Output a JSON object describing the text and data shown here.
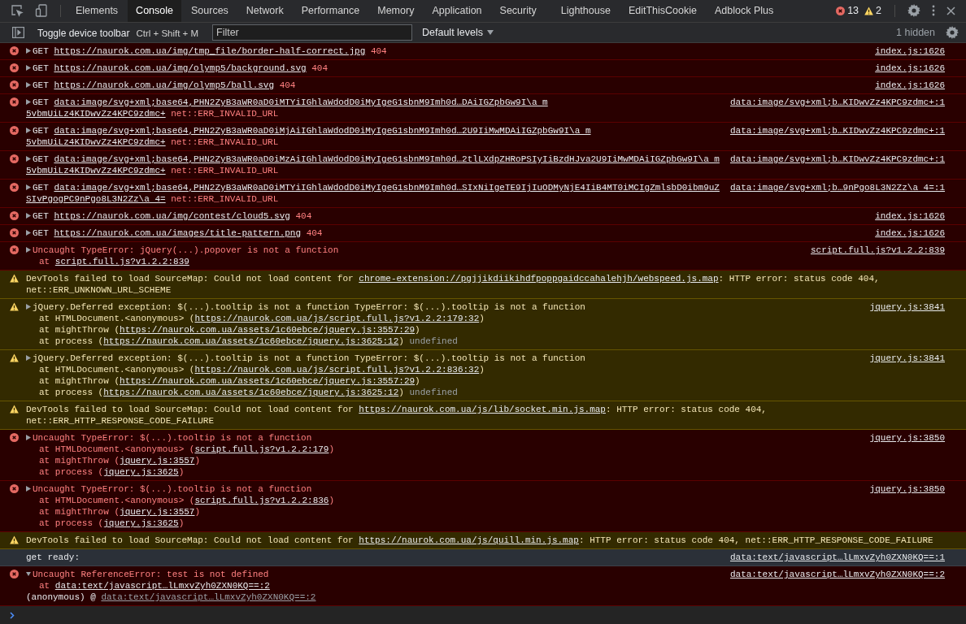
{
  "toolbar": {
    "tabs": [
      {
        "label": "Elements",
        "selected": false
      },
      {
        "label": "Console",
        "selected": true
      },
      {
        "label": "Sources",
        "selected": false
      },
      {
        "label": "Network",
        "selected": false
      },
      {
        "label": "Performance",
        "selected": false
      },
      {
        "label": "Memory",
        "selected": false
      },
      {
        "label": "Application",
        "selected": false
      },
      {
        "label": "Security",
        "selected": false
      },
      {
        "label": "Lighthouse",
        "selected": false
      },
      {
        "label": "EditThisCookie",
        "selected": false
      },
      {
        "label": "Adblock Plus",
        "selected": false
      }
    ],
    "error_count": "13",
    "warning_count": "2"
  },
  "filter_bar": {
    "tooltip": {
      "label": "Toggle device toolbar",
      "shortcut": "Ctrl + Shift + M"
    },
    "filter": {
      "placeholder": "Filter"
    },
    "levels": "Default levels",
    "hidden": "1 hidden"
  },
  "messages": [
    {
      "kind": "error",
      "expanded": false,
      "source": "index.js:1626",
      "lines": [
        {
          "kind": "main",
          "parts": [
            {
              "kind": "bright",
              "t": "GET "
            },
            {
              "kind": "link",
              "t": "https://naurok.com.ua/img/tmp_file/border-half-correct.jpg"
            },
            {
              "kind": "text",
              "t": " 404"
            }
          ]
        }
      ]
    },
    {
      "kind": "error",
      "expanded": false,
      "source": "index.js:1626",
      "lines": [
        {
          "kind": "main",
          "parts": [
            {
              "kind": "bright",
              "t": "GET "
            },
            {
              "kind": "link",
              "t": "https://naurok.com.ua/img/olymp5/background.svg"
            },
            {
              "kind": "text",
              "t": " 404"
            }
          ]
        }
      ]
    },
    {
      "kind": "error",
      "expanded": false,
      "source": "index.js:1626",
      "lines": [
        {
          "kind": "main",
          "parts": [
            {
              "kind": "bright",
              "t": "GET "
            },
            {
              "kind": "link",
              "t": "https://naurok.com.ua/img/olymp5/ball.svg"
            },
            {
              "kind": "text",
              "t": " 404"
            }
          ]
        }
      ]
    },
    {
      "kind": "error",
      "expanded": false,
      "source": "data:image/svg+xml;b…KIDwvZz4KPC9zdmc+:1",
      "lines": [
        {
          "kind": "main",
          "parts": [
            {
              "kind": "bright",
              "t": "GET "
            },
            {
              "kind": "link",
              "t": "data:image/svg+xml;base64,PHN2ZyB3aWR0aD0iMTYiIGhlaWdodD0iMyIgeG1sbnM9Imh0d…DAiIGZpbGw9I\\a m"
            }
          ]
        },
        {
          "kind": "wrap",
          "parts": [
            {
              "kind": "link",
              "t": "5vbmUiLz4KIDwvZz4KPC9zdmc+"
            },
            {
              "kind": "text",
              "t": " net::ERR_INVALID_URL"
            }
          ]
        }
      ]
    },
    {
      "kind": "error",
      "expanded": false,
      "source": "data:image/svg+xml;b…KIDwvZz4KPC9zdmc+:1",
      "lines": [
        {
          "kind": "main",
          "parts": [
            {
              "kind": "bright",
              "t": "GET "
            },
            {
              "kind": "link",
              "t": "data:image/svg+xml;base64,PHN2ZyB3aWR0aD0iMjAiIGhlaWdodD0iMyIgeG1sbnM9Imh0d…2U9IiMwMDAiIGZpbGw9I\\a m"
            }
          ]
        },
        {
          "kind": "wrap",
          "parts": [
            {
              "kind": "link",
              "t": "5vbmUiLz4KIDwvZz4KPC9zdmc+"
            },
            {
              "kind": "text",
              "t": " net::ERR_INVALID_URL"
            }
          ]
        }
      ]
    },
    {
      "kind": "error",
      "expanded": false,
      "source": "data:image/svg+xml;b…KIDwvZz4KPC9zdmc+:1",
      "lines": [
        {
          "kind": "main",
          "parts": [
            {
              "kind": "bright",
              "t": "GET "
            },
            {
              "kind": "link",
              "t": "data:image/svg+xml;base64,PHN2ZyB3aWR0aD0iMzAiIGhlaWdodD0iMyIgeG1sbnM9Imh0d…2tlLXdpZHRoPSIyIiBzdHJva2U9IiMwMDAiIGZpbGw9I\\a m"
            }
          ]
        },
        {
          "kind": "wrap",
          "parts": [
            {
              "kind": "link",
              "t": "5vbmUiLz4KIDwvZz4KPC9zdmc+"
            },
            {
              "kind": "text",
              "t": " net::ERR_INVALID_URL"
            }
          ]
        }
      ]
    },
    {
      "kind": "error",
      "expanded": false,
      "source": "data:image/svg+xml;b…9nPgo8L3N2Zz\\a 4=:1",
      "lines": [
        {
          "kind": "main",
          "parts": [
            {
              "kind": "bright",
              "t": "GET "
            },
            {
              "kind": "link",
              "t": "data:image/svg+xml;base64,PHN2ZyB3aWR0aD0iMTYiIGhlaWdodD0iMyIgeG1sbnM9Imh0d…SIxNiIgeTE9IjIuODMyNjE4IiB4MT0iMCIgZmlsbD0ibm9uZ"
            }
          ]
        },
        {
          "kind": "wrap",
          "parts": [
            {
              "kind": "link",
              "t": "SIvPgogPC9nPgo8L3N2Zz\\a 4="
            },
            {
              "kind": "text",
              "t": " net::ERR_INVALID_URL"
            }
          ]
        }
      ]
    },
    {
      "kind": "error",
      "expanded": false,
      "source": "index.js:1626",
      "lines": [
        {
          "kind": "main",
          "parts": [
            {
              "kind": "bright",
              "t": "GET "
            },
            {
              "kind": "link",
              "t": "https://naurok.com.ua/img/contest/cloud5.svg"
            },
            {
              "kind": "text",
              "t": " 404"
            }
          ]
        }
      ]
    },
    {
      "kind": "error",
      "expanded": false,
      "source": "index.js:1626",
      "lines": [
        {
          "kind": "main",
          "parts": [
            {
              "kind": "bright",
              "t": "GET "
            },
            {
              "kind": "link",
              "t": "https://naurok.com.ua/images/title-pattern.png"
            },
            {
              "kind": "text",
              "t": " 404"
            }
          ]
        }
      ]
    },
    {
      "kind": "error",
      "expanded": false,
      "source": "script.full.js?v1.2.2:839",
      "lines": [
        {
          "kind": "main",
          "parts": [
            {
              "kind": "text",
              "t": "Uncaught TypeError: jQuery(...).popover is not a function"
            }
          ]
        },
        {
          "kind": "stack",
          "parts": [
            {
              "kind": "text",
              "t": "at "
            },
            {
              "kind": "link",
              "t": "script.full.js?v1.2.2:839"
            }
          ]
        }
      ]
    },
    {
      "kind": "warning",
      "lines": [
        {
          "kind": "main",
          "parts": [
            {
              "kind": "text",
              "t": "DevTools failed to load SourceMap: Could not load content for "
            },
            {
              "kind": "link",
              "t": "chrome-extension://pgjjikdiikihdfpoppgaidccahalehjh/webspeed.js.map"
            },
            {
              "kind": "text",
              "t": ": HTTP error: status code 404,"
            }
          ]
        },
        {
          "kind": "plainwrap",
          "parts": [
            {
              "kind": "text",
              "t": "net::ERR_UNKNOWN_URL_SCHEME"
            }
          ]
        }
      ]
    },
    {
      "kind": "warning",
      "expanded": false,
      "source": "jquery.js:3841",
      "lines": [
        {
          "kind": "main",
          "parts": [
            {
              "kind": "text",
              "t": "jQuery.Deferred exception: $(...).tooltip is not a function TypeError: $(...).tooltip is not a function"
            }
          ]
        },
        {
          "kind": "stack",
          "parts": [
            {
              "kind": "text",
              "t": "at HTMLDocument.<anonymous> ("
            },
            {
              "kind": "link",
              "t": "https://naurok.com.ua/js/script.full.js?v1.2.2:179:32"
            },
            {
              "kind": "text",
              "t": ")"
            }
          ]
        },
        {
          "kind": "stack",
          "parts": [
            {
              "kind": "text",
              "t": "at mightThrow ("
            },
            {
              "kind": "link",
              "t": "https://naurok.com.ua/assets/1c60ebce/jquery.js:3557:29"
            },
            {
              "kind": "text",
              "t": ")"
            }
          ]
        },
        {
          "kind": "stack",
          "parts": [
            {
              "kind": "text",
              "t": "at process ("
            },
            {
              "kind": "link",
              "t": "https://naurok.com.ua/assets/1c60ebce/jquery.js:3625:12"
            },
            {
              "kind": "text",
              "t": ") "
            },
            {
              "kind": "dim",
              "t": "undefined"
            }
          ]
        }
      ]
    },
    {
      "kind": "warning",
      "expanded": false,
      "source": "jquery.js:3841",
      "lines": [
        {
          "kind": "main",
          "parts": [
            {
              "kind": "text",
              "t": "jQuery.Deferred exception: $(...).tooltip is not a function TypeError: $(...).tooltip is not a function"
            }
          ]
        },
        {
          "kind": "stack",
          "parts": [
            {
              "kind": "text",
              "t": "at HTMLDocument.<anonymous> ("
            },
            {
              "kind": "link",
              "t": "https://naurok.com.ua/js/script.full.js?v1.2.2:836:32"
            },
            {
              "kind": "text",
              "t": ")"
            }
          ]
        },
        {
          "kind": "stack",
          "parts": [
            {
              "kind": "text",
              "t": "at mightThrow ("
            },
            {
              "kind": "link",
              "t": "https://naurok.com.ua/assets/1c60ebce/jquery.js:3557:29"
            },
            {
              "kind": "text",
              "t": ")"
            }
          ]
        },
        {
          "kind": "stack",
          "parts": [
            {
              "kind": "text",
              "t": "at process ("
            },
            {
              "kind": "link",
              "t": "https://naurok.com.ua/assets/1c60ebce/jquery.js:3625:12"
            },
            {
              "kind": "text",
              "t": ") "
            },
            {
              "kind": "dim",
              "t": "undefined"
            }
          ]
        }
      ]
    },
    {
      "kind": "warning",
      "lines": [
        {
          "kind": "main",
          "parts": [
            {
              "kind": "text",
              "t": "DevTools failed to load SourceMap: Could not load content for "
            },
            {
              "kind": "link",
              "t": "https://naurok.com.ua/js/lib/socket.min.js.map"
            },
            {
              "kind": "text",
              "t": ": HTTP error: status code 404,"
            }
          ]
        },
        {
          "kind": "plainwrap",
          "parts": [
            {
              "kind": "text",
              "t": "net::ERR_HTTP_RESPONSE_CODE_FAILURE"
            }
          ]
        }
      ]
    },
    {
      "kind": "error",
      "expanded": false,
      "source": "jquery.js:3850",
      "lines": [
        {
          "kind": "main",
          "parts": [
            {
              "kind": "text",
              "t": "Uncaught TypeError: $(...).tooltip is not a function"
            }
          ]
        },
        {
          "kind": "stack",
          "parts": [
            {
              "kind": "text",
              "t": "at HTMLDocument.<anonymous> ("
            },
            {
              "kind": "link",
              "t": "script.full.js?v1.2.2:179"
            },
            {
              "kind": "text",
              "t": ")"
            }
          ]
        },
        {
          "kind": "stack",
          "parts": [
            {
              "kind": "text",
              "t": "at mightThrow ("
            },
            {
              "kind": "link",
              "t": "jquery.js:3557"
            },
            {
              "kind": "text",
              "t": ")"
            }
          ]
        },
        {
          "kind": "stack",
          "parts": [
            {
              "kind": "text",
              "t": "at process ("
            },
            {
              "kind": "link",
              "t": "jquery.js:3625"
            },
            {
              "kind": "text",
              "t": ")"
            }
          ]
        }
      ]
    },
    {
      "kind": "error",
      "expanded": false,
      "source": "jquery.js:3850",
      "lines": [
        {
          "kind": "main",
          "parts": [
            {
              "kind": "text",
              "t": "Uncaught TypeError: $(...).tooltip is not a function"
            }
          ]
        },
        {
          "kind": "stack",
          "parts": [
            {
              "kind": "text",
              "t": "at HTMLDocument.<anonymous> ("
            },
            {
              "kind": "link",
              "t": "script.full.js?v1.2.2:836"
            },
            {
              "kind": "text",
              "t": ")"
            }
          ]
        },
        {
          "kind": "stack",
          "parts": [
            {
              "kind": "text",
              "t": "at mightThrow ("
            },
            {
              "kind": "link",
              "t": "jquery.js:3557"
            },
            {
              "kind": "text",
              "t": ")"
            }
          ]
        },
        {
          "kind": "stack",
          "parts": [
            {
              "kind": "text",
              "t": "at process ("
            },
            {
              "kind": "link",
              "t": "jquery.js:3625"
            },
            {
              "kind": "text",
              "t": ")"
            }
          ]
        }
      ]
    },
    {
      "kind": "warning",
      "lines": [
        {
          "kind": "main",
          "parts": [
            {
              "kind": "text",
              "t": "DevTools failed to load SourceMap: Could not load content for "
            },
            {
              "kind": "link",
              "t": "https://naurok.com.ua/js/quill.min.js.map"
            },
            {
              "kind": "text",
              "t": ": HTTP error: status code 404, net::ERR_HTTP_RESPONSE_CODE_FAILURE"
            }
          ]
        }
      ]
    },
    {
      "kind": "info",
      "source": "data:text/javascript…lLmxvZyh0ZXN0KQ==:1",
      "lines": [
        {
          "kind": "main",
          "parts": [
            {
              "kind": "text",
              "t": "get ready:"
            }
          ]
        }
      ]
    },
    {
      "kind": "error",
      "expanded": true,
      "source": "data:text/javascript…lLmxvZyh0ZXN0KQ==:2",
      "lines": [
        {
          "kind": "main",
          "parts": [
            {
              "kind": "text",
              "t": "Uncaught ReferenceError: test is not defined"
            }
          ]
        },
        {
          "kind": "stack",
          "parts": [
            {
              "kind": "text",
              "t": "at "
            },
            {
              "kind": "link",
              "t": "data:text/javascript…lLmxvZyh0ZXN0KQ==:2"
            }
          ]
        },
        {
          "kind": "trace",
          "parts": [
            {
              "kind": "bright",
              "t": "(anonymous) @ "
            },
            {
              "kind": "dimlink",
              "t": "data:text/javascript…lLmxvZyh0ZXN0KQ==:2"
            }
          ]
        }
      ]
    }
  ]
}
